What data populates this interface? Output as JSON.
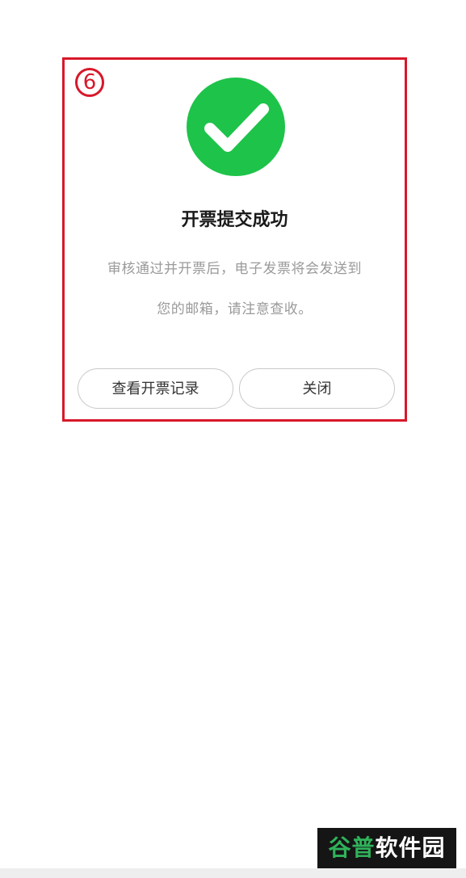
{
  "step_marker": "6",
  "dialog": {
    "title": "开票提交成功",
    "message_line_1": "审核通过并开票后，电子发票将会发送到",
    "message_line_2": "您的邮箱，请注意查收。",
    "view_records_label": "查看开票记录",
    "close_label": "关闭"
  },
  "icons": {
    "success": "check-circle-icon"
  },
  "colors": {
    "highlight": "#d8182a",
    "success_green": "#1ec34a"
  },
  "watermark": {
    "text_part_1": "谷普",
    "text_part_2": "软件园"
  }
}
